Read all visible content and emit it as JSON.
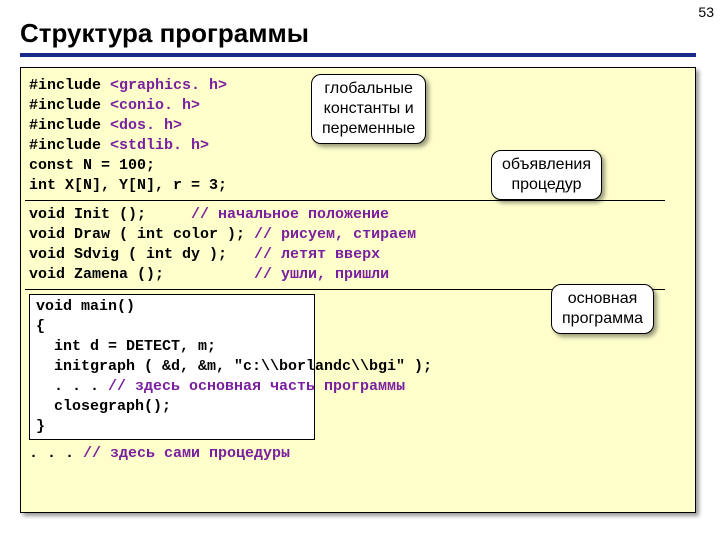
{
  "page_number": "53",
  "title": "Структура программы",
  "code": {
    "inc1": "<graphics. h>",
    "inc2": "<conio. h>",
    "inc3": "<dos. h>",
    "inc4": "<stdlib. h>",
    "const_line": "const N = 100;",
    "intxy_line": "int X[N], Y[N], r = 3;",
    "decl1_a": "void Init ();     ",
    "decl1_c": "// начальное положение",
    "decl2_a": "void Draw ( int color ); ",
    "decl2_c": "// рисуем, стираем",
    "decl3_a": "void Sdvig ( int dy );   ",
    "decl3_c": "// летят вверх",
    "decl4_a": "void Zamena ();          ",
    "decl4_c": "// ушли, пришли",
    "main1": "void main()",
    "main2": "{",
    "main3": "  int d = DETECT, m;",
    "main4": "  initgraph ( &d, &m, \"c:\\\\borlandc\\\\bgi\" );",
    "main5a": "  . . . ",
    "main5c": "// здесь основная часть программы",
    "main6": "  closegraph();",
    "main7": "}",
    "tail_a": ". . . ",
    "tail_c": "// здесь сами процедуры",
    "kw_include": "#include "
  },
  "callouts": {
    "c1_l1": "глобальные",
    "c1_l2": "константы и",
    "c1_l3": "переменные",
    "c2_l1": "объявления",
    "c2_l2": "процедур",
    "c3_l1": "основная",
    "c3_l2": "программа"
  }
}
